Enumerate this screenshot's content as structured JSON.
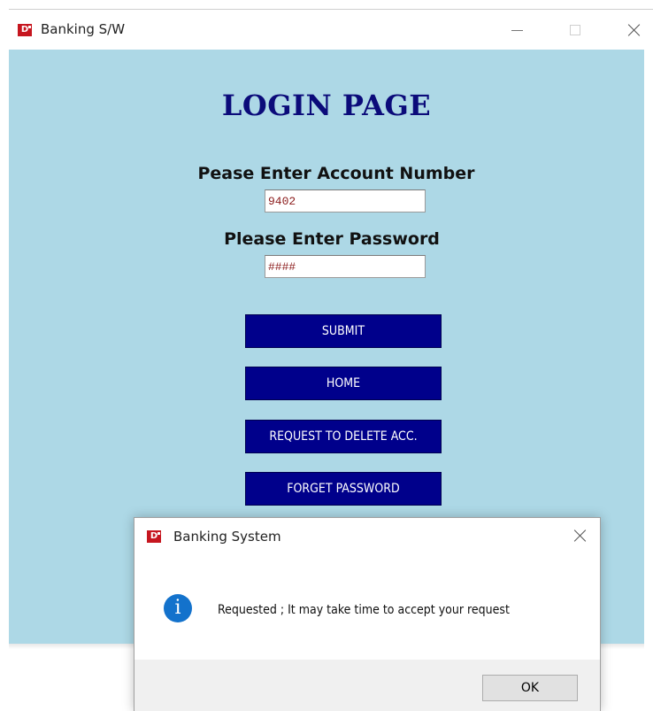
{
  "window": {
    "title": "Banking S/W",
    "icon_label": "D"
  },
  "login": {
    "page_title": "LOGIN PAGE",
    "account_label": "Pease Enter Account Number",
    "account_value": "9402",
    "password_label": "Please Enter Password",
    "password_value": "####",
    "buttons": {
      "submit": "SUBMIT",
      "home": "HOME",
      "delete": "REQUEST TO DELETE ACC.",
      "forget": "FORGET PASSWORD"
    }
  },
  "dialog": {
    "title": "Banking System",
    "icon_label": "D",
    "info_glyph": "i",
    "message": "Requested ; It may take time to accept your request",
    "ok_label": "OK"
  },
  "colors": {
    "background": "#add8e6",
    "button": "#00008b",
    "title": "#0b0b7a",
    "app_icon": "#c6161f",
    "info_icon": "#1372cc"
  }
}
